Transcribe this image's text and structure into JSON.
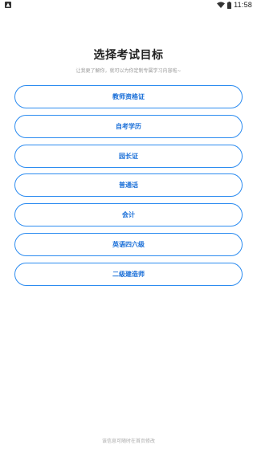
{
  "status_bar": {
    "time": "11:58",
    "notification_icon": "app-notification-icon",
    "wifi_icon": "wifi-icon",
    "battery_icon": "battery-icon"
  },
  "title": "选择考试目标",
  "subtitle": "让我更了解你，就可以为你定制专属学习内容啦~",
  "options": [
    {
      "label": "教师资格证"
    },
    {
      "label": "自考学历"
    },
    {
      "label": "园长证"
    },
    {
      "label": "普通话"
    },
    {
      "label": "会计"
    },
    {
      "label": "英语四六级"
    },
    {
      "label": "二级建造师"
    }
  ],
  "footer_note": "该信息可随时在首页修改",
  "colors": {
    "accent": "#2d8cf0",
    "accent_text": "#1a6fd8",
    "title": "#222222",
    "muted": "#999999"
  }
}
